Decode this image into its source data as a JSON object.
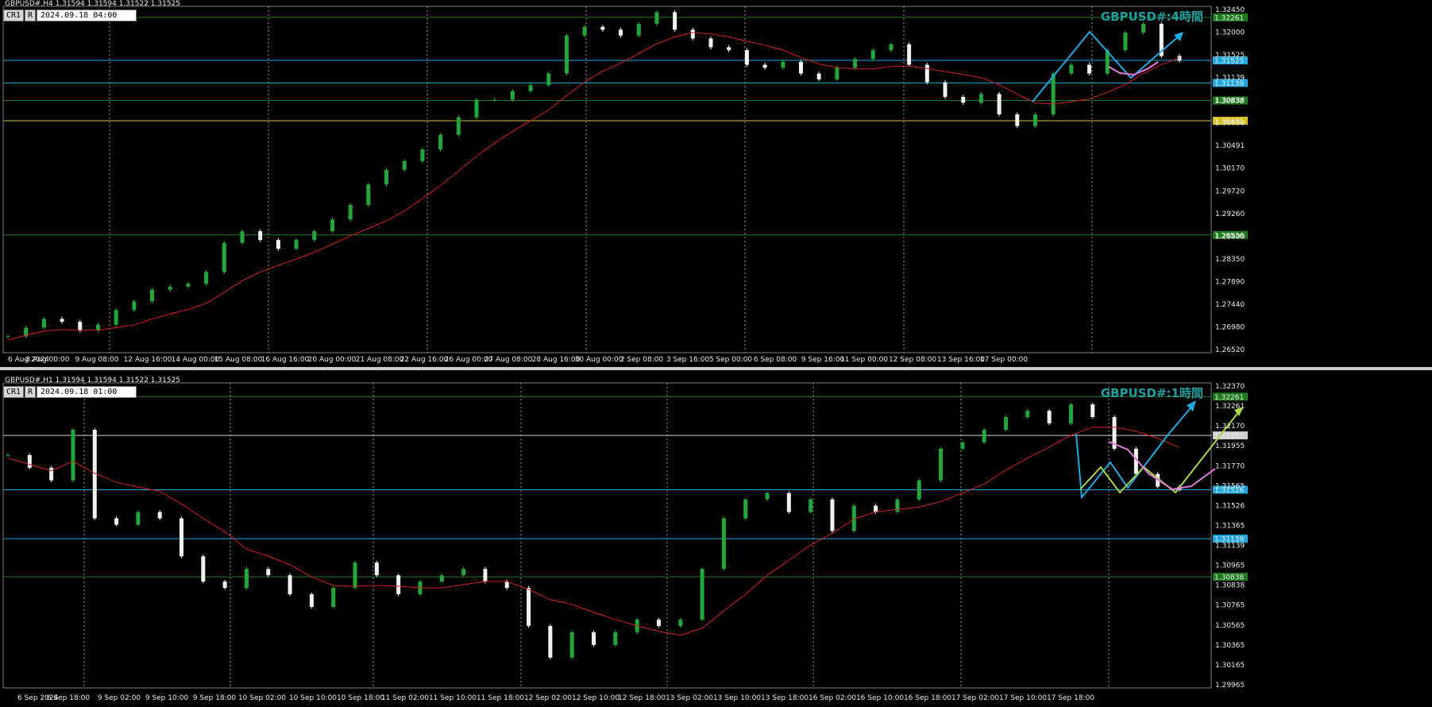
{
  "top": {
    "symbol_line": "GBPUSD#,H4  1.31594 1.31594 1.31522 1.31525",
    "btn_cr": "CR1",
    "btn_r": "R",
    "time_box": "2024.09.18 04:00",
    "corner_title": "GBPUSD#:4時間",
    "price_axis": [
      "1.32450",
      "1.32000",
      "1.31525",
      "1.31139",
      "1.30838",
      "1.30630",
      "1.30491",
      "1.30170",
      "1.29720",
      "1.29260",
      "1.28800",
      "1.28350",
      "1.27890",
      "1.27440",
      "1.26980",
      "1.26520"
    ],
    "marked": [
      {
        "label": "1.32261",
        "color": "#1c7c1c"
      },
      {
        "label": "1.31525",
        "color": "#1fa9e0"
      },
      {
        "label": "1.31139",
        "color": "#1fa9e0"
      },
      {
        "label": "1.30838",
        "color": "#1c7c1c"
      },
      {
        "label": "1.30491",
        "color": "#d8c31a"
      },
      {
        "label": "1.28536",
        "color": "#1c7c1c"
      }
    ],
    "time_axis": [
      "6 Aug 2024",
      "8 Aug 00:00",
      "9 Aug 08:00",
      "12 Aug 16:00",
      "14 Aug 00:00",
      "15 Aug 08:00",
      "16 Aug 16:00",
      "20 Aug 00:00",
      "21 Aug 08:00",
      "22 Aug 16:00",
      "26 Aug 00:00",
      "27 Aug 08:00",
      "28 Aug 16:00",
      "30 Aug 00:00",
      "2 Sep 08:00",
      "3 Sep 16:00",
      "5 Sep 00:00",
      "6 Sep 08:00",
      "9 Sep 16:00",
      "11 Sep 00:00",
      "12 Sep 08:00",
      "13 Sep 16:00",
      "17 Sep 00:00"
    ]
  },
  "bottom": {
    "symbol_line": "GBPUSD#,H1  1.31594 1.31594 1.31522 1.31525",
    "btn_cr": "CR1",
    "btn_r": "R",
    "time_box": "2024.09.18 01:00",
    "corner_title": "GBPUSD#:1時間",
    "price_axis": [
      "1.32370",
      "1.32261",
      "1.32170",
      "1.31955",
      "1.31770",
      "1.31565",
      "1.31526",
      "1.31365",
      "1.31139",
      "1.30965",
      "1.30838",
      "1.30765",
      "1.30565",
      "1.30365",
      "1.30165",
      "1.29965"
    ],
    "marked": [
      {
        "label": "1.32261",
        "color": "#1c7c1c"
      },
      {
        "label": "1.31955",
        "color": "#d0d0d0"
      },
      {
        "label": "1.31526",
        "color": "#1fa9e0"
      },
      {
        "label": "1.31139",
        "color": "#1fa9e0"
      },
      {
        "label": "1.30838",
        "color": "#1c7c1c"
      }
    ],
    "time_axis": [
      "6 Sep 2024",
      "6 Sep 18:00",
      "9 Sep 02:00",
      "9 Sep 10:00",
      "9 Sep 18:00",
      "10 Sep 02:00",
      "10 Sep 10:00",
      "10 Sep 18:00",
      "11 Sep 02:00",
      "11 Sep 10:00",
      "11 Sep 18:00",
      "12 Sep 02:00",
      "12 Sep 10:00",
      "12 Sep 18:00",
      "13 Sep 02:00",
      "13 Sep 10:00",
      "13 Sep 18:00",
      "16 Sep 02:00",
      "16 Sep 10:00",
      "16 Sep 18:00",
      "17 Sep 02:00",
      "17 Sep 10:00",
      "17 Sep 18:00"
    ]
  },
  "chart_data": [
    {
      "type": "candlestick",
      "symbol": "GBPUSD#",
      "timeframe": "H4",
      "ylim": [
        1.2652,
        1.3245
      ],
      "levels": [
        1.32261,
        1.31525,
        1.31139,
        1.30838,
        1.30491,
        1.28536
      ],
      "close_path": [
        1.268,
        1.2695,
        1.271,
        1.2705,
        1.269,
        1.27,
        1.2725,
        1.274,
        1.276,
        1.2765,
        1.277,
        1.279,
        1.284,
        1.286,
        1.2845,
        1.283,
        1.2845,
        1.286,
        1.288,
        1.2905,
        1.294,
        1.2965,
        1.298,
        1.3,
        1.3025,
        1.3055,
        1.3085,
        1.3085,
        1.31,
        1.311,
        1.313,
        1.3195,
        1.321,
        1.3205,
        1.3195,
        1.3215,
        1.3235,
        1.3205,
        1.319,
        1.3175,
        1.317,
        1.3145,
        1.314,
        1.315,
        1.313,
        1.312,
        1.314,
        1.3155,
        1.317,
        1.318,
        1.3145,
        1.3115,
        1.309,
        1.308,
        1.3095,
        1.306,
        1.304,
        1.306,
        1.313,
        1.3145,
        1.313,
        1.317,
        1.32,
        1.3215,
        1.316,
        1.3152
      ]
    },
    {
      "type": "candlestick",
      "symbol": "GBPUSD#",
      "timeframe": "H1",
      "ylim": [
        1.2996,
        1.3237
      ],
      "levels": [
        1.32261,
        1.31955,
        1.31526,
        1.31139,
        1.30838
      ],
      "close_path": [
        1.318,
        1.317,
        1.316,
        1.32,
        1.313,
        1.3125,
        1.3135,
        1.313,
        1.31,
        1.308,
        1.3075,
        1.309,
        1.3085,
        1.307,
        1.306,
        1.3075,
        1.3095,
        1.3085,
        1.307,
        1.308,
        1.3085,
        1.309,
        1.308,
        1.3075,
        1.3045,
        1.302,
        1.304,
        1.303,
        1.304,
        1.305,
        1.3045,
        1.305,
        1.309,
        1.313,
        1.3145,
        1.315,
        1.3135,
        1.3145,
        1.312,
        1.314,
        1.3135,
        1.3145,
        1.316,
        1.3185,
        1.319,
        1.32,
        1.321,
        1.3215,
        1.3205,
        1.322,
        1.321,
        1.3185,
        1.3165,
        1.3155,
        1.31525
      ]
    }
  ]
}
